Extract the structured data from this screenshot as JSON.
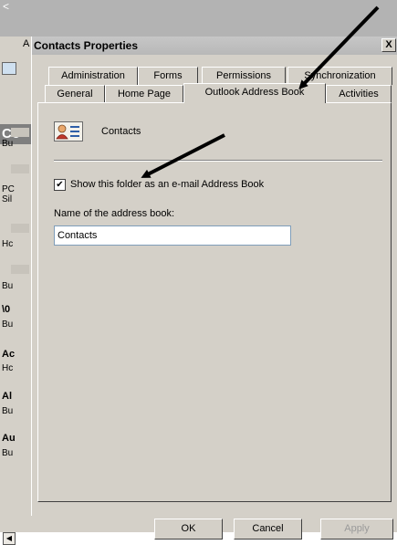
{
  "background": {
    "topbar_glyph": "<",
    "title_fragment": "A",
    "heading_fragment": "Co",
    "items": [
      {
        "text": "Bu",
        "bold": false
      },
      {
        "text": "PC",
        "bold": false
      },
      {
        "text": "Sil",
        "bold": false
      },
      {
        "text": "Hc",
        "bold": false
      },
      {
        "text": "Bu",
        "bold": false
      },
      {
        "text": "\\0",
        "bold": true
      },
      {
        "text": "Bu",
        "bold": false
      },
      {
        "text": "Ac",
        "bold": true
      },
      {
        "text": "Hc",
        "bold": false
      },
      {
        "text": "Al",
        "bold": true
      },
      {
        "text": "Bu",
        "bold": false
      },
      {
        "text": "Au",
        "bold": true
      },
      {
        "text": "Bu",
        "bold": false
      }
    ]
  },
  "dialog": {
    "title": "Contacts Properties",
    "close_label": "X",
    "tabs_back": [
      "Administration",
      "Forms",
      "Permissions",
      "Synchronization"
    ],
    "tabs_front": [
      "General",
      "Home Page",
      "Outlook Address Book",
      "Activities"
    ],
    "active_tab": "Outlook Address Book",
    "folder_name": "Contacts",
    "folder_icon": "contacts-card-icon",
    "show_checkbox": {
      "label": "Show this folder as an e-mail Address Book",
      "checked": true
    },
    "address_book_label": "Name of the address book:",
    "address_book_value": "Contacts",
    "buttons": {
      "ok": "OK",
      "cancel": "Cancel",
      "apply": "Apply"
    }
  },
  "annotations": {
    "arrow_color": "#000000"
  }
}
